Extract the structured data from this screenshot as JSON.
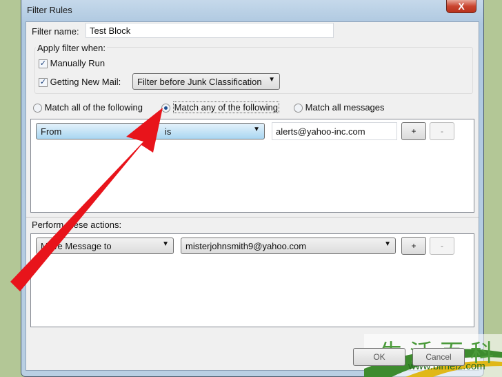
{
  "window": {
    "title": "Filter Rules",
    "close_label": "X"
  },
  "filter_name": {
    "label": "Filter name:",
    "value": "Test Block"
  },
  "apply": {
    "label": "Apply filter when:",
    "manually_run": {
      "label": "Manually Run",
      "checked": true
    },
    "new_mail": {
      "label": "Getting New Mail:",
      "checked": true,
      "option": "Filter before Junk Classification"
    }
  },
  "match": {
    "options": [
      "Match all of the following",
      "Match any of the following",
      "Match all messages"
    ],
    "selected": 1
  },
  "rule": {
    "field": "From",
    "operator": "is",
    "value": "alerts@yahoo-inc.com",
    "add": "+",
    "remove": "-"
  },
  "actions": {
    "label": "Perform these actions:",
    "action": "Move Message to",
    "target": "misterjohnsmith9@yahoo.com",
    "add": "+",
    "remove": "-"
  },
  "footer": {
    "ok": "OK",
    "cancel": "Cancel"
  },
  "watermark": {
    "text": "生活百科",
    "url": "www.bimeiz.com"
  },
  "colors": {
    "annotation_arrow": "#e8141b",
    "background": "#b3c796"
  }
}
